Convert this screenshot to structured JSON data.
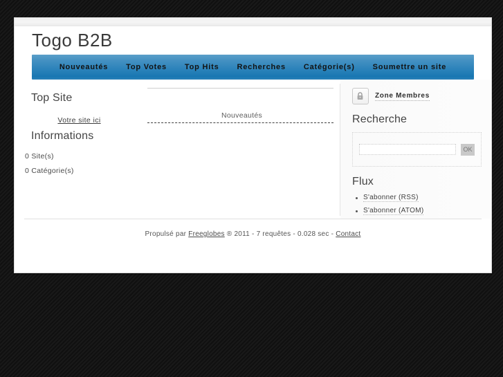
{
  "header": {
    "site_title": "Togo B2B"
  },
  "nav": {
    "items": [
      {
        "label": "Nouveautés",
        "name": "nav-item-nouveautes"
      },
      {
        "label": "Top Votes",
        "name": "nav-item-top-votes"
      },
      {
        "label": "Top Hits",
        "name": "nav-item-top-hits"
      },
      {
        "label": "Recherches",
        "name": "nav-item-recherches"
      },
      {
        "label": "Catégorie(s)",
        "name": "nav-item-categories"
      },
      {
        "label": "Soumettre un site",
        "name": "nav-item-soumettre"
      }
    ]
  },
  "left_column": {
    "top_site_title": "Top Site",
    "top_site_link": "Votre site ici",
    "informations_title": "Informations",
    "stats": [
      "0 Site(s)",
      "0 Catégorie(s)"
    ]
  },
  "center_column": {
    "news_heading": "Nouveautés"
  },
  "right_column": {
    "member_zone_label": "Zone Membres",
    "lock_icon": "lock-icon",
    "search_title": "Recherche",
    "search_value": "",
    "search_placeholder": "",
    "search_button_label": "OK",
    "flux_title": "Flux",
    "flux_links": [
      "S'abonner (RSS)",
      "S'abonner (ATOM)"
    ]
  },
  "footer": {
    "prefix": "Propulsé par ",
    "engine_link": "Freeglobes",
    "middle": " ® 2011 - 7 requêtes - 0.028 sec - ",
    "contact_link": "Contact"
  },
  "colors": {
    "nav_blue_top": "#5a9fc9",
    "nav_blue_bottom": "#1877b2",
    "page_background": "#141414",
    "panel_white": "#ffffff"
  }
}
